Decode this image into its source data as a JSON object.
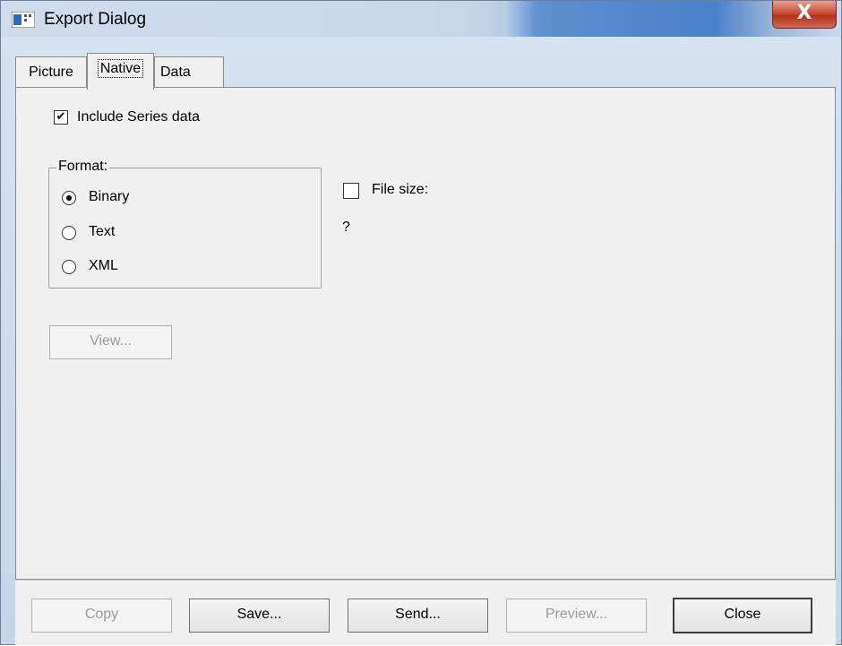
{
  "window": {
    "title": "Export Dialog",
    "close_label": "X"
  },
  "tabs": [
    {
      "label": "Picture"
    },
    {
      "label": "Native"
    },
    {
      "label": "Data"
    }
  ],
  "active_tab": "Native",
  "native": {
    "include_series_label": "Include Series data",
    "include_series_checked": true,
    "format_label": "Format:",
    "formats": [
      {
        "label": "Binary",
        "selected": true
      },
      {
        "label": "Text",
        "selected": false
      },
      {
        "label": "XML",
        "selected": false
      }
    ],
    "file_size_label": "File size:",
    "file_size_checked": false,
    "file_size_value": "?",
    "view_button": "View..."
  },
  "buttons": {
    "copy": "Copy",
    "save": "Save...",
    "send": "Send...",
    "preview": "Preview...",
    "close": "Close"
  }
}
